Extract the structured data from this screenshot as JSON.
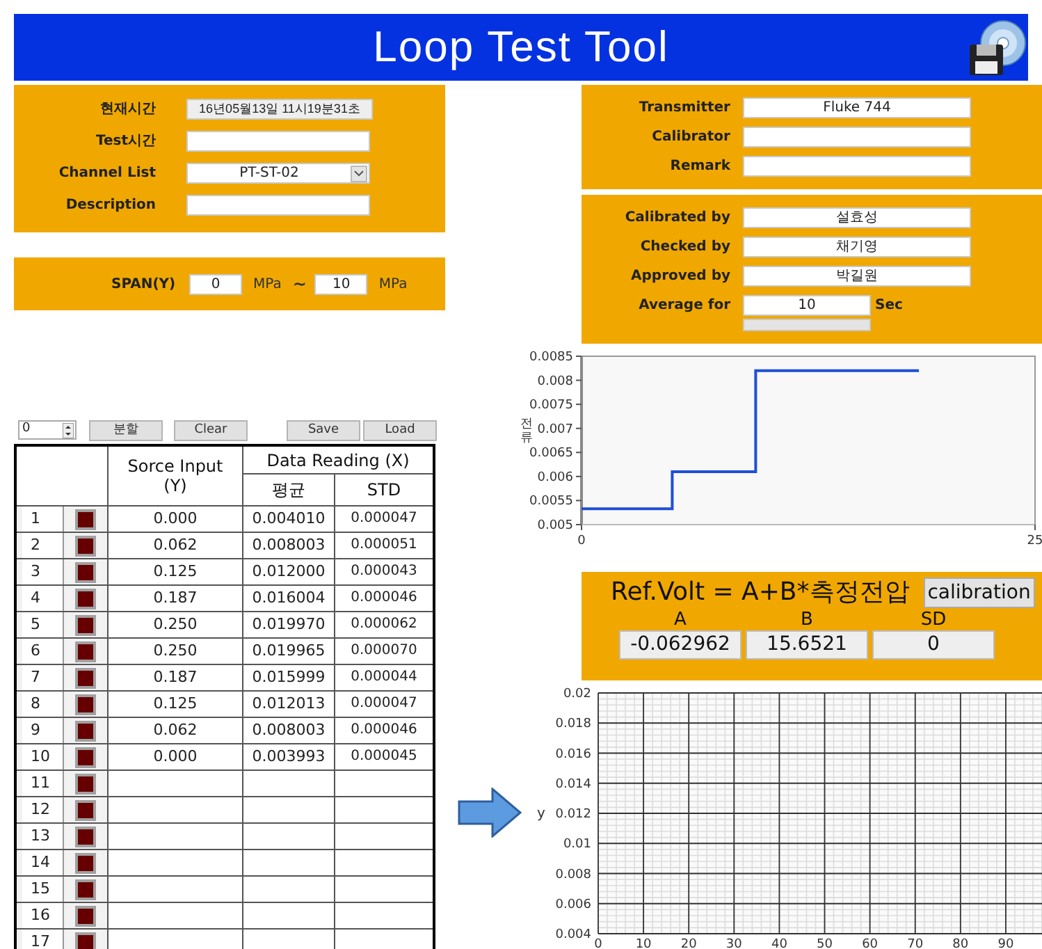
{
  "window": {
    "title": "Loop Test Tool"
  },
  "info_panel": {
    "fields": [
      {
        "label": "현재시간",
        "value": "16년05월13일 11시19분31초",
        "kind": "indicator"
      },
      {
        "label": "Test시간",
        "kind": "text"
      },
      {
        "label": "Channel List",
        "value": "PT-ST-02",
        "kind": "dropdown"
      },
      {
        "label": "Description",
        "kind": "text"
      }
    ]
  },
  "span": {
    "label": "SPAN(Y)",
    "min": "0",
    "min_unit": "MPa",
    "separator": "~",
    "max": "10",
    "max_unit": "MPa"
  },
  "device_panel": {
    "fields": [
      {
        "label": "Transmitter",
        "value": "Fluke 744"
      },
      {
        "label": "Calibrator"
      },
      {
        "label": "Remark"
      }
    ]
  },
  "people_panel": {
    "fields": [
      {
        "label": "Calibrated by",
        "value": "설효성"
      },
      {
        "label": "Checked by",
        "value": "채기영"
      },
      {
        "label": "Approved by",
        "value": "박길원"
      }
    ],
    "average": {
      "label": "Average for",
      "value": "10",
      "unit": "Sec",
      "level": 0
    }
  },
  "toolbar": {
    "counter": "0",
    "buttons": [
      "분할",
      "Clear",
      "Save",
      "Load"
    ]
  },
  "table": {
    "columns": {
      "source": "Sorce Input\n(Y)",
      "data": "Data Reading (X)",
      "avg": "평균",
      "std": "STD"
    },
    "rows": [
      {
        "index": "1",
        "on": false,
        "source": "0.000",
        "avg": "0.004010",
        "std": "0.000047"
      },
      {
        "index": "2",
        "on": false,
        "source": "0.062",
        "avg": "0.008003",
        "std": "0.000051"
      },
      {
        "index": "3",
        "on": false,
        "source": "0.125",
        "avg": "0.012000",
        "std": "0.000043"
      },
      {
        "index": "4",
        "on": false,
        "source": "0.187",
        "avg": "0.016004",
        "std": "0.000046"
      },
      {
        "index": "5",
        "on": false,
        "source": "0.250",
        "avg": "0.019970",
        "std": "0.000062"
      },
      {
        "index": "6",
        "on": false,
        "source": "0.250",
        "avg": "0.019965",
        "std": "0.000070"
      },
      {
        "index": "7",
        "on": false,
        "source": "0.187",
        "avg": "0.015999",
        "std": "0.000044"
      },
      {
        "index": "8",
        "on": false,
        "source": "0.125",
        "avg": "0.012013",
        "std": "0.000047"
      },
      {
        "index": "9",
        "on": false,
        "source": "0.062",
        "avg": "0.008003",
        "std": "0.000046"
      },
      {
        "index": "10",
        "on": false,
        "source": "0.000",
        "avg": "0.003993",
        "std": "0.000045"
      },
      {
        "index": "11",
        "on": false
      },
      {
        "index": "12",
        "on": false
      },
      {
        "index": "13",
        "on": false
      },
      {
        "index": "14",
        "on": false
      },
      {
        "index": "15",
        "on": false
      },
      {
        "index": "16",
        "on": false
      },
      {
        "index": "17",
        "on": false
      }
    ]
  },
  "current_chart": {
    "chart_data": {
      "type": "line",
      "ylabel": "전류",
      "x": [
        0,
        5,
        5,
        9.6,
        9.6,
        18.6
      ],
      "series": [
        {
          "color": "#1f4fd8",
          "values": [
            0.00533,
            0.00533,
            0.0061,
            0.0061,
            0.0082,
            0.0082
          ]
        }
      ],
      "xlim": [
        0,
        25
      ],
      "ylim": [
        0.005,
        0.0085
      ],
      "xticks": [
        0,
        25
      ],
      "yticks": [
        {
          "value": 0.005,
          "label": "0.005"
        },
        {
          "value": 0.0055,
          "label": "0.0055"
        },
        {
          "value": 0.006,
          "label": "0.006"
        },
        {
          "value": 0.0065,
          "label": "0.0065"
        },
        {
          "value": 0.007,
          "label": "0.007"
        },
        {
          "value": 0.0075,
          "label": "0.0075"
        },
        {
          "value": 0.008,
          "label": "0.008"
        },
        {
          "value": 0.0085,
          "label": "0.0085"
        }
      ]
    }
  },
  "calibration": {
    "equation": "Ref.Volt = A+B*측정전압",
    "button": "calibration",
    "coefficients": [
      {
        "label": "A",
        "value": "-0.062962"
      },
      {
        "label": "B",
        "value": "15.6521"
      },
      {
        "label": "SD",
        "value": "0"
      }
    ]
  },
  "fit_chart": {
    "chart_data": {
      "type": "scatter",
      "ylabel": "y",
      "grid": true,
      "xlim": [
        0,
        98
      ],
      "ylim": [
        0.004,
        0.02
      ],
      "xticks": [
        0,
        10,
        20,
        30,
        40,
        50,
        60,
        70,
        80,
        90
      ],
      "yticks": [
        {
          "value": 0.004,
          "label": "0.004"
        },
        {
          "value": 0.006,
          "label": "0.006"
        },
        {
          "value": 0.008,
          "label": "0.008"
        },
        {
          "value": 0.01,
          "label": "0.01"
        },
        {
          "value": 0.012,
          "label": "0.012"
        },
        {
          "value": 0.014,
          "label": "0.014"
        },
        {
          "value": 0.016,
          "label": "0.016"
        },
        {
          "value": 0.018,
          "label": "0.018"
        },
        {
          "value": 0.02,
          "label": "0.02"
        }
      ]
    }
  }
}
